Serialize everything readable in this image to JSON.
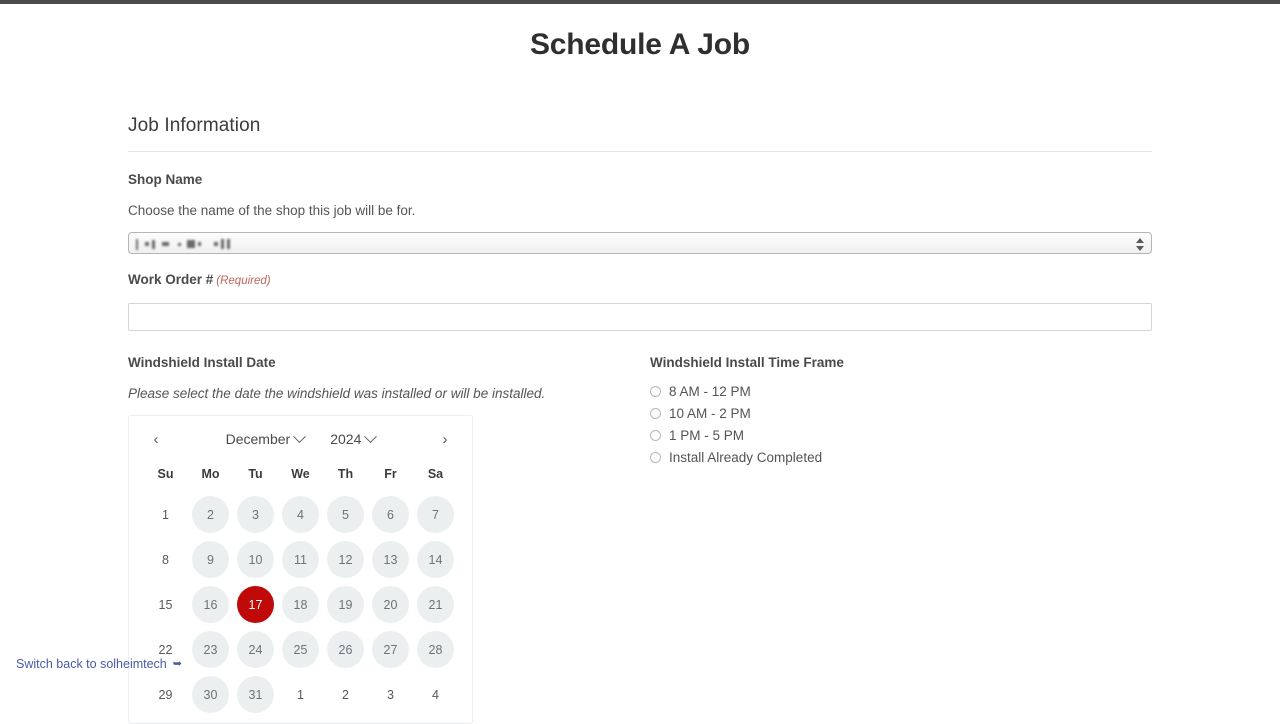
{
  "page": {
    "title": "Schedule A Job",
    "top_bar_color": "#4a4a4d"
  },
  "section": {
    "legend": "Job Information"
  },
  "shop_name": {
    "label": "Shop Name",
    "description": "Choose the name of the shop this job will be for.",
    "selected_value": "",
    "value_redacted": true
  },
  "work_order": {
    "label": "Work Order #",
    "required_note": "(Required)",
    "value": "",
    "placeholder": ""
  },
  "install_date": {
    "label": "Windshield Install Date",
    "description": "Please select the date the windshield was installed or will be installed.",
    "calendar": {
      "prev_label": "‹",
      "next_label": "›",
      "month": "December",
      "year": "2024",
      "selected_day": 17,
      "day_headers": [
        "Su",
        "Mo",
        "Tu",
        "We",
        "Th",
        "Fr",
        "Sa"
      ],
      "weeks": [
        [
          {
            "n": 1,
            "state": "disabled"
          },
          {
            "n": 2,
            "state": "avail"
          },
          {
            "n": 3,
            "state": "avail"
          },
          {
            "n": 4,
            "state": "avail"
          },
          {
            "n": 5,
            "state": "avail"
          },
          {
            "n": 6,
            "state": "avail"
          },
          {
            "n": 7,
            "state": "avail"
          }
        ],
        [
          {
            "n": 8,
            "state": "disabled"
          },
          {
            "n": 9,
            "state": "avail"
          },
          {
            "n": 10,
            "state": "avail"
          },
          {
            "n": 11,
            "state": "avail"
          },
          {
            "n": 12,
            "state": "avail"
          },
          {
            "n": 13,
            "state": "avail"
          },
          {
            "n": 14,
            "state": "avail"
          }
        ],
        [
          {
            "n": 15,
            "state": "disabled"
          },
          {
            "n": 16,
            "state": "avail"
          },
          {
            "n": 17,
            "state": "selected"
          },
          {
            "n": 18,
            "state": "avail"
          },
          {
            "n": 19,
            "state": "avail"
          },
          {
            "n": 20,
            "state": "avail"
          },
          {
            "n": 21,
            "state": "avail"
          }
        ],
        [
          {
            "n": 22,
            "state": "disabled"
          },
          {
            "n": 23,
            "state": "avail"
          },
          {
            "n": 24,
            "state": "avail"
          },
          {
            "n": 25,
            "state": "avail"
          },
          {
            "n": 26,
            "state": "avail"
          },
          {
            "n": 27,
            "state": "avail"
          },
          {
            "n": 28,
            "state": "avail"
          }
        ],
        [
          {
            "n": 29,
            "state": "disabled"
          },
          {
            "n": 30,
            "state": "avail"
          },
          {
            "n": 31,
            "state": "avail"
          },
          {
            "n": 1,
            "state": "other"
          },
          {
            "n": 2,
            "state": "other"
          },
          {
            "n": 3,
            "state": "other"
          },
          {
            "n": 4,
            "state": "other"
          }
        ]
      ]
    }
  },
  "time_frame": {
    "label": "Windshield Install Time Frame",
    "options": [
      {
        "label": "8 AM - 12 PM",
        "selected": false
      },
      {
        "label": "10 AM - 2 PM",
        "selected": false
      },
      {
        "label": "1 PM - 5 PM",
        "selected": false
      },
      {
        "label": "Install Already Completed",
        "selected": false
      }
    ]
  },
  "switch_link": {
    "label": "Switch back to solheimtech",
    "icon": "external-link-icon"
  },
  "colors": {
    "selected_day": "#c00a0a",
    "day_pill": "#eceff0",
    "required": "#c0655a",
    "link": "#4a5ba8"
  }
}
